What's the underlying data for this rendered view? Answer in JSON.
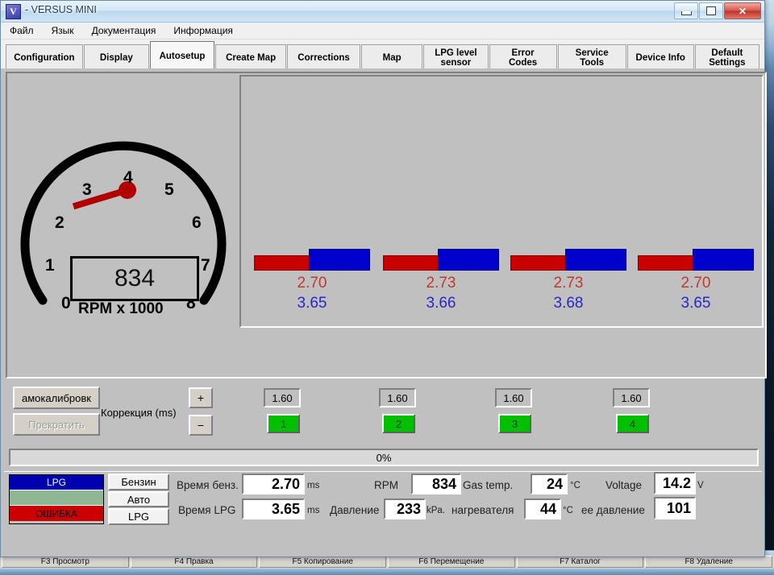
{
  "window": {
    "title": "- VERSUS MINI",
    "icon": "app-icon",
    "buttons": {
      "minimize": "minimize",
      "maximize": "maximize",
      "close": "✕"
    }
  },
  "menu": {
    "items": [
      "Файл",
      "Язык",
      "Документация",
      "Информация"
    ]
  },
  "tabs": [
    {
      "label": "Configuration",
      "active": false
    },
    {
      "label": "Display",
      "active": false
    },
    {
      "label": "Autosetup",
      "active": true
    },
    {
      "label": "Create Map",
      "active": false
    },
    {
      "label": "Corrections",
      "active": false
    },
    {
      "label": "Map",
      "active": false
    },
    {
      "label": "LPG level sensor",
      "line1": "LPG level",
      "line2": "sensor",
      "active": false
    },
    {
      "label": "Error Codes",
      "active": false
    },
    {
      "label": "Service Tools",
      "active": false
    },
    {
      "label": "Device Info",
      "active": false
    },
    {
      "label": "Default Settings",
      "line1": "Default",
      "line2": "Settings",
      "active": false
    }
  ],
  "gauge": {
    "caption": "RPM x 1000",
    "ticks": [
      "0",
      "1",
      "2",
      "3",
      "4",
      "5",
      "6",
      "7",
      "8"
    ],
    "value_display": "834",
    "needle_value": 0.834,
    "max": 8,
    "needle_color": "#b00000"
  },
  "chart_data": {
    "type": "bar",
    "title": "",
    "categories": [
      "1",
      "2",
      "3",
      "4"
    ],
    "series": [
      {
        "name": "Время бенз.",
        "color": "#c80000",
        "values": [
          2.7,
          2.73,
          2.73,
          2.7
        ],
        "unit": "ms"
      },
      {
        "name": "Время LPG",
        "color": "#0000cc",
        "values": [
          3.65,
          3.66,
          3.68,
          3.65
        ],
        "unit": "ms"
      }
    ],
    "labels_red": [
      "2.70",
      "2.73",
      "2.73",
      "2.70"
    ],
    "labels_blue": [
      "3.65",
      "3.66",
      "3.68",
      "3.65"
    ],
    "xlabel": "",
    "ylabel": "",
    "grid": false,
    "legend": "none"
  },
  "calibration": {
    "autocal_button": "амокалибровк",
    "stop_button": "Прекратить",
    "correction_label": "Коррекция (ms)",
    "plus_button": "+",
    "minus_button": "−",
    "cylinders": [
      {
        "value": "1.60",
        "index": "1"
      },
      {
        "value": "1.60",
        "index": "2"
      },
      {
        "value": "1.60",
        "index": "3"
      },
      {
        "value": "1.60",
        "index": "4"
      }
    ]
  },
  "progress": {
    "text": "0%",
    "percent": 0
  },
  "status": {
    "leds": [
      {
        "label": "LPG",
        "bg": "#0000b0",
        "fg": "#ffffff"
      },
      {
        "label": "",
        "bg": "#8fb695",
        "fg": "#000000"
      },
      {
        "label": "ОШИБКА",
        "bg": "#cc0000",
        "fg": "#000000"
      }
    ],
    "modes": [
      "Бензин",
      "Авто",
      "LPG"
    ],
    "readouts": [
      {
        "label": "Время бенз.",
        "value": "2.70",
        "unit": "ms"
      },
      {
        "label": "Время LPG",
        "value": "3.65",
        "unit": "ms"
      },
      {
        "label": "RPM",
        "value": "834",
        "unit": ""
      },
      {
        "label": "Давление",
        "value": "233",
        "unit": "kPa."
      },
      {
        "label": "Gas temp.",
        "value": "24",
        "unit": "°C"
      },
      {
        "label": "нагревателя",
        "value": "44",
        "unit": "°C"
      },
      {
        "label": "Voltage",
        "value": "14.2",
        "unit": "V"
      },
      {
        "label": "ее давление",
        "value": "101",
        "unit": ""
      }
    ]
  },
  "background_window": {
    "function_keys": [
      "F3 Просмотр",
      "F4 Правка",
      "F5 Копирование",
      "F6 Перемещение",
      "F7 Каталог",
      "F8 Удаление"
    ]
  }
}
